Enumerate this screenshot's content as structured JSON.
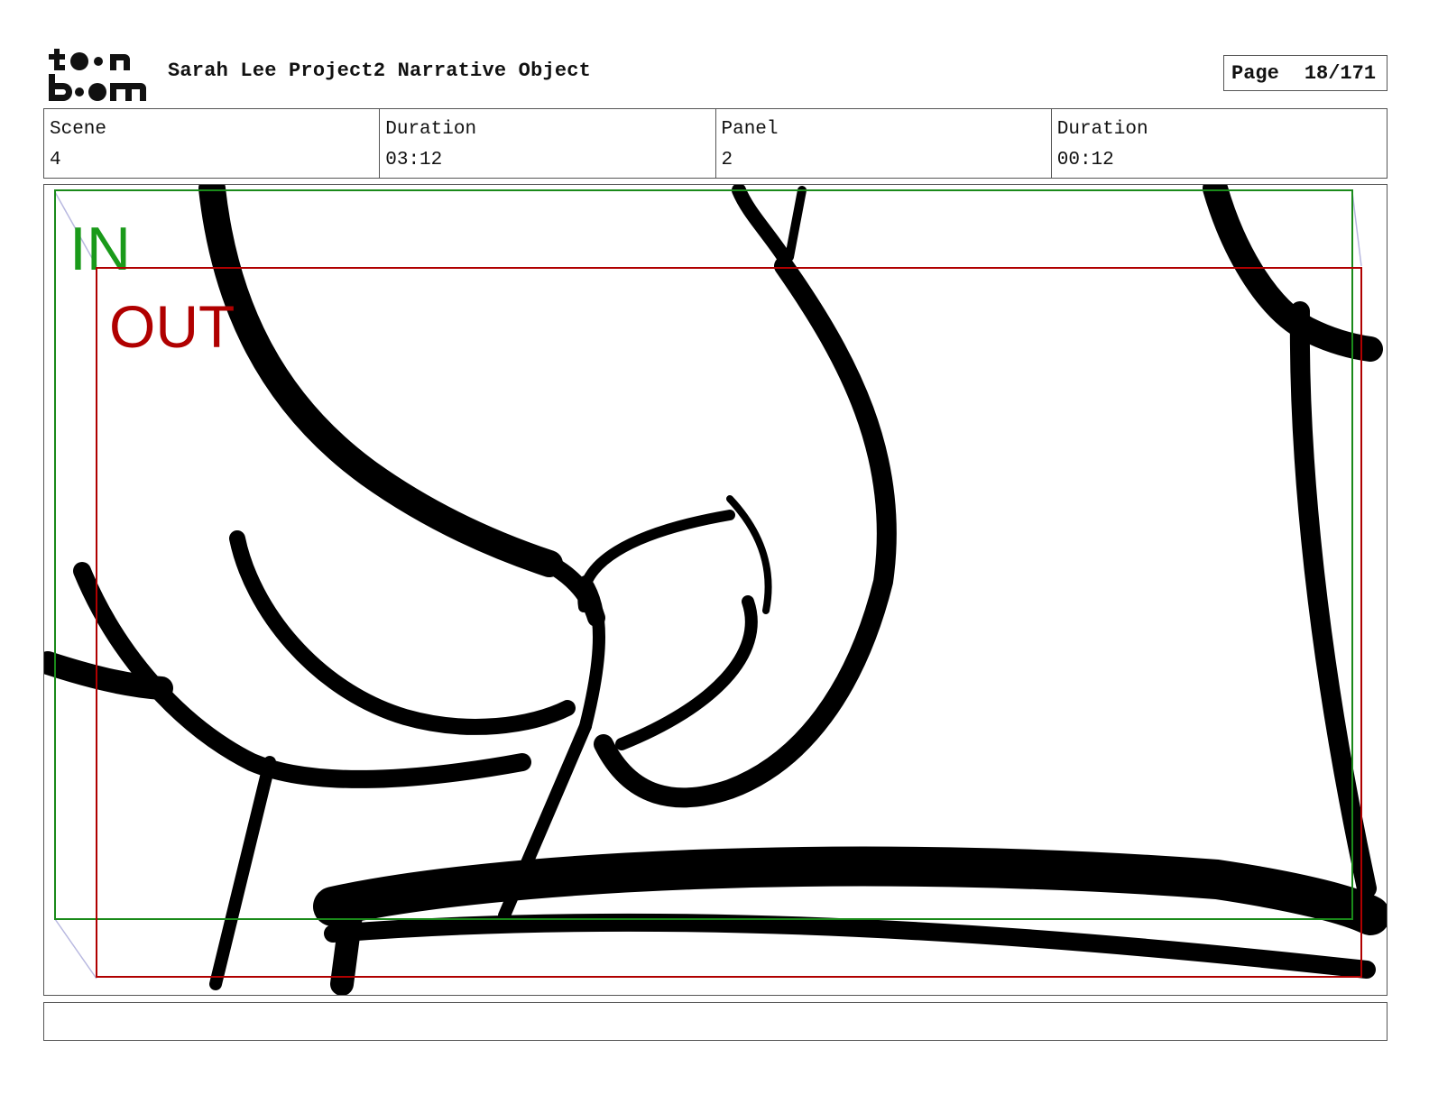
{
  "header": {
    "logo_text": "toon boom",
    "title": "Sarah Lee Project2 Narrative Object",
    "page_label": "Page",
    "page_value": "18/171"
  },
  "info": {
    "scene_label": "Scene",
    "scene_value": "4",
    "scene_duration_label": "Duration",
    "scene_duration_value": "03:12",
    "panel_label": "Panel",
    "panel_value": "2",
    "panel_duration_label": "Duration",
    "panel_duration_value": "00:12"
  },
  "panel": {
    "in_label": "IN",
    "out_label": "OUT",
    "in_color": "#1a9a1a",
    "out_color": "#b00000"
  },
  "caption": {
    "text": ""
  }
}
